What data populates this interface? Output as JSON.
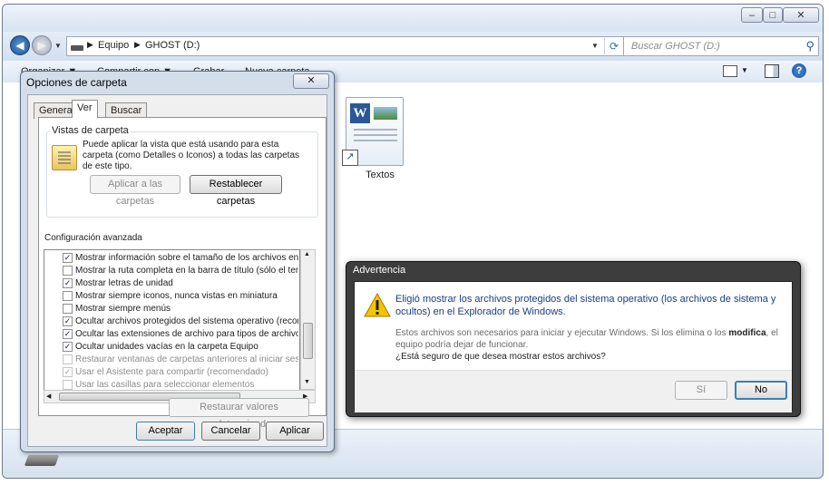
{
  "explorer": {
    "address_parts": [
      "Equipo",
      "GHOST (D:)"
    ],
    "search_placeholder": "Buscar GHOST (D:)",
    "toolbar": {
      "organize": "Organizar ▼",
      "share": "Compartir con ▼",
      "burn": "Grabar",
      "new_folder": "Nueva carpeta"
    },
    "file": {
      "name": "Textos",
      "icon": "word-document-shortcut-icon"
    }
  },
  "folder_options": {
    "title": "Opciones de carpeta",
    "close_glyph": "✕",
    "tabs": [
      "General",
      "Ver",
      "Buscar"
    ],
    "active_tab": "Ver",
    "folder_views": {
      "group_label": "Vistas de carpeta",
      "description": "Puede aplicar la vista que está usando para esta carpeta (como Detalles o Iconos) a todas las carpetas de este tipo.",
      "apply_button": "Aplicar a las carpetas",
      "reset_button": "Restablecer carpetas"
    },
    "advanced": {
      "label": "Configuración avanzada",
      "items": [
        {
          "text": "Mostrar información sobre el tamaño de los archivos en su",
          "checked": true,
          "enabled": true
        },
        {
          "text": "Mostrar la ruta completa en la barra de título (sólo el tema",
          "checked": false,
          "enabled": true
        },
        {
          "text": "Mostrar letras de unidad",
          "checked": true,
          "enabled": true
        },
        {
          "text": "Mostrar siempre iconos, nunca vistas en miniatura",
          "checked": false,
          "enabled": true
        },
        {
          "text": "Mostrar siempre menús",
          "checked": false,
          "enabled": true
        },
        {
          "text": "Ocultar archivos protegidos del sistema operativo (recome",
          "checked": true,
          "enabled": true
        },
        {
          "text": "Ocultar las extensiones de archivo para tipos de archivo c",
          "checked": true,
          "enabled": true
        },
        {
          "text": "Ocultar unidades vacías en la carpeta Equipo",
          "checked": true,
          "enabled": true
        },
        {
          "text": "Restaurar ventanas de carpetas anteriores al iniciar sesió",
          "checked": false,
          "enabled": false
        },
        {
          "text": "Usar el Asistente para compartir (recomendado)",
          "checked": true,
          "enabled": false
        },
        {
          "text": "Usar las casillas para seleccionar elementos",
          "checked": false,
          "enabled": false
        }
      ]
    },
    "restore_defaults": "Restaurar valores predeterminados",
    "ok": "Aceptar",
    "cancel": "Cancelar",
    "apply": "Aplicar"
  },
  "warning": {
    "title": "Advertencia",
    "main_text": "Eligió mostrar los archivos protegidos del sistema operativo (los archivos de sistema y ocultos) en el Explorador de Windows.",
    "detail_prefix": "Estos archivos son necesarios para iniciar y ejecutar Windows. Si los elimina o los ",
    "detail_bold": "modifica",
    "detail_suffix": ", el equipo podría dejar de funcionar.",
    "question": "¿Está seguro de que desea mostrar estos archivos?",
    "yes": "Sí",
    "no": "No"
  },
  "colors": {
    "accent_blue": "#3c7fb1",
    "warning_yellow": "#f5c400",
    "title_dark": "#3d3d3d"
  }
}
